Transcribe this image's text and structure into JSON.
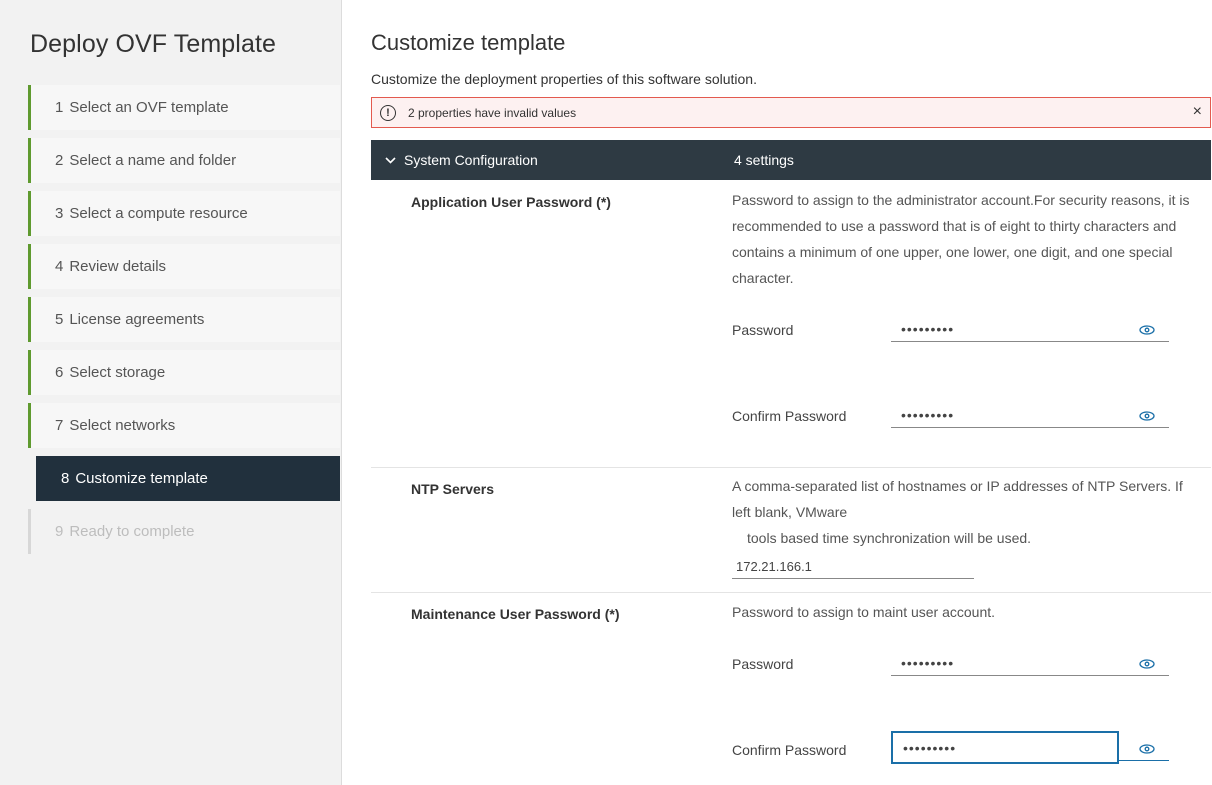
{
  "wizard": {
    "title": "Deploy OVF Template",
    "steps": [
      {
        "num": "1",
        "label": "Select an OVF template",
        "state": "done"
      },
      {
        "num": "2",
        "label": "Select a name and folder",
        "state": "done"
      },
      {
        "num": "3",
        "label": "Select a compute resource",
        "state": "done"
      },
      {
        "num": "4",
        "label": "Review details",
        "state": "done"
      },
      {
        "num": "5",
        "label": "License agreements",
        "state": "done"
      },
      {
        "num": "6",
        "label": "Select storage",
        "state": "done"
      },
      {
        "num": "7",
        "label": "Select networks",
        "state": "done"
      },
      {
        "num": "8",
        "label": "Customize template",
        "state": "active"
      },
      {
        "num": "9",
        "label": "Ready to complete",
        "state": "disabled"
      }
    ]
  },
  "main": {
    "title": "Customize template",
    "subtitle": "Customize the deployment properties of this software solution.",
    "alert": {
      "icon": "exclamation-circle-icon",
      "text": "2 properties have invalid values",
      "close": "×"
    },
    "section": {
      "title": "System Configuration",
      "count": "4 settings"
    },
    "app_password": {
      "label": "Application User Password (*)",
      "description": "Password to assign to the administrator account.For security reasons, it is recommended to use a password that is of eight to thirty characters and contains a minimum of one upper, one lower, one digit, and one special character.",
      "password_label": "Password",
      "password_value": "•••••••••",
      "confirm_label": "Confirm Password",
      "confirm_value": "•••••••••"
    },
    "ntp": {
      "label": "NTP Servers",
      "description_line1": "A comma-separated list of hostnames or IP addresses of NTP Servers. If left blank, VMware",
      "description_line2": "tools based time synchronization will be used.",
      "value": "172.21.166.1"
    },
    "maint_password": {
      "label": "Maintenance User Password (*)",
      "description": "Password to assign to maint user account.",
      "password_label": "Password",
      "password_value": "•••••••••",
      "confirm_label": "Confirm Password",
      "confirm_value": "•••••••••"
    }
  },
  "colors": {
    "nav_active": "#21303d",
    "section_header": "#2e3a43",
    "step_done_bar": "#5f9a2f",
    "error_border": "#e35a4f",
    "focus": "#1a6fa8"
  }
}
